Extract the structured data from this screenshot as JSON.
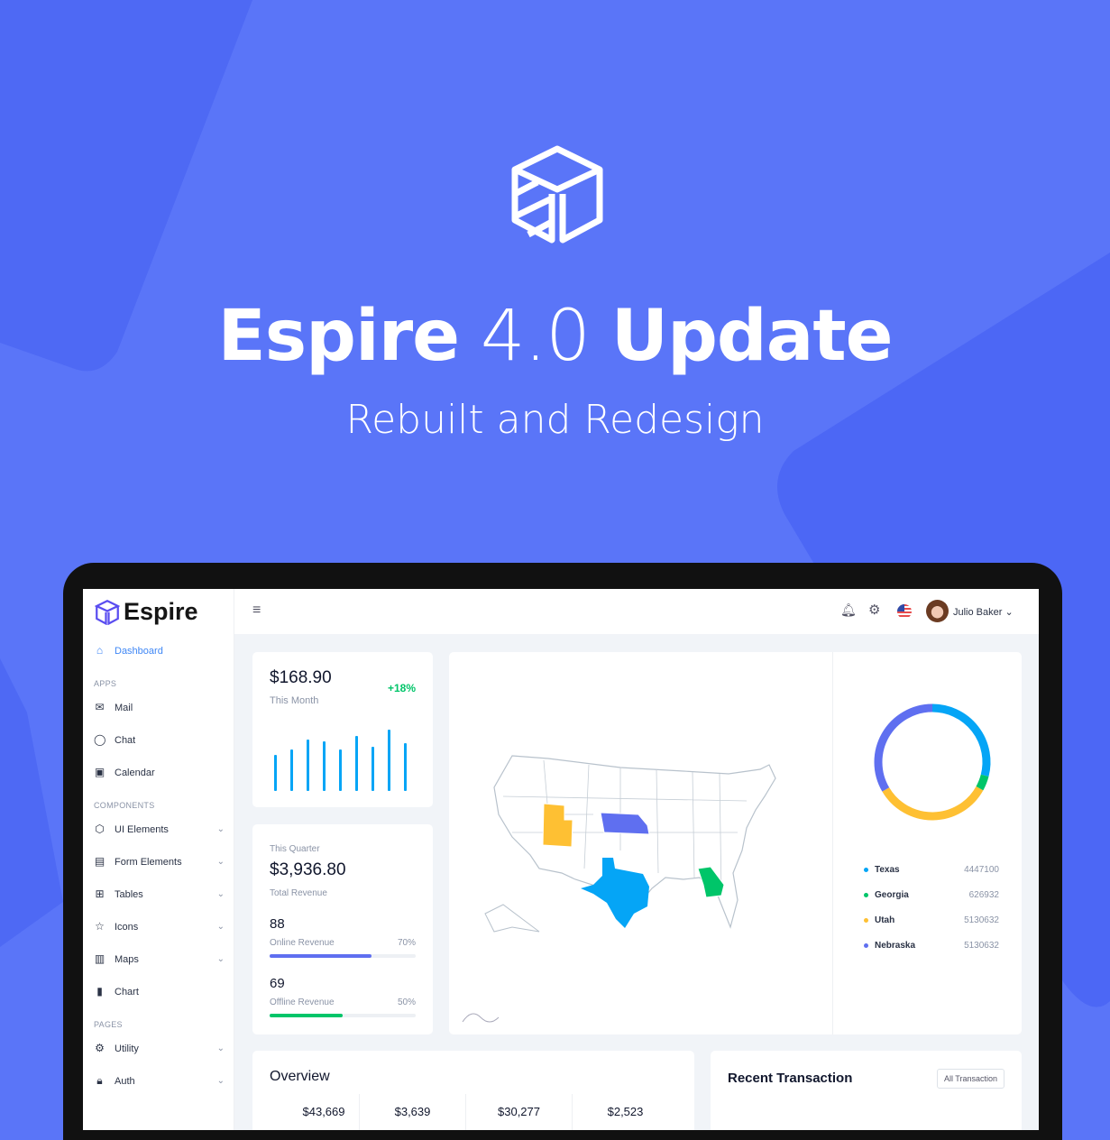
{
  "hero": {
    "title_bold_1": "Espire",
    "title_light": "4.0",
    "title_bold_2": "Update",
    "subtitle": "Rebuilt and Redesign"
  },
  "colors": {
    "background": "#5a75f8",
    "primary": "#3f87f5",
    "success": "#00c569",
    "warning": "#fec033",
    "indigo": "#5f6ff0"
  },
  "app": {
    "brand": "Espire"
  },
  "sidebar": {
    "active": {
      "label": "Dashboard",
      "icon": "home-icon"
    },
    "sections": [
      {
        "title": "APPS",
        "items": [
          {
            "label": "Mail",
            "icon": "mail-icon"
          },
          {
            "label": "Chat",
            "icon": "chat-icon"
          },
          {
            "label": "Calendar",
            "icon": "calendar-icon"
          }
        ]
      },
      {
        "title": "COMPONENTS",
        "items": [
          {
            "label": "UI Elements",
            "icon": "box-icon"
          },
          {
            "label": "Form Elements",
            "icon": "file-icon"
          },
          {
            "label": "Tables",
            "icon": "grid-icon"
          },
          {
            "label": "Icons",
            "icon": "star-icon"
          },
          {
            "label": "Maps",
            "icon": "map-icon"
          },
          {
            "label": "Chart",
            "icon": "bar-chart-icon"
          }
        ]
      },
      {
        "title": "PAGES",
        "items": [
          {
            "label": "Utility",
            "icon": "gear-icon"
          },
          {
            "label": "Auth",
            "icon": "lock-icon"
          }
        ]
      }
    ]
  },
  "topbar": {
    "user": "Julio Baker"
  },
  "month_card": {
    "value": "$168.90",
    "label": "This Month",
    "change": "+18%",
    "bars": [
      0.52,
      0.6,
      0.75,
      0.72,
      0.6,
      0.8,
      0.64,
      0.9,
      0.7
    ]
  },
  "quarter_card": {
    "label": "This Quarter",
    "value": "$3,936.80",
    "sub": "Total Revenue",
    "online": {
      "value": "88",
      "label": "Online Revenue",
      "percent": 70
    },
    "offline": {
      "value": "69",
      "label": "Offline Revenue",
      "percent": 50
    }
  },
  "map_legend": [
    {
      "state": "Texas",
      "value": "4447100",
      "color": "#05a5f6"
    },
    {
      "state": "Georgia",
      "value": "626932",
      "color": "#00c569"
    },
    {
      "state": "Utah",
      "value": "5130632",
      "color": "#fec033"
    },
    {
      "state": "Nebraska",
      "value": "5130632",
      "color": "#5f6ff0"
    }
  ],
  "overview": {
    "title": "Overview",
    "values": [
      "$43,669",
      "$3,639",
      "$30,277",
      "$2,523"
    ]
  },
  "transactions": {
    "title": "Recent Transaction",
    "button": "All Transaction"
  }
}
